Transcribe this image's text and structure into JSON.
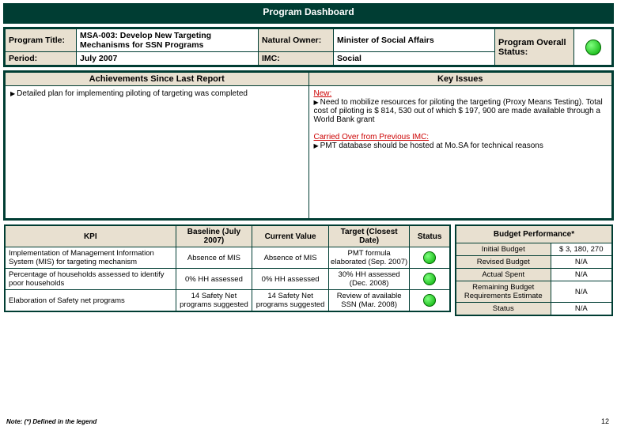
{
  "title": "Program Dashboard",
  "header": {
    "program_title_lbl": "Program Title:",
    "program_title_val": "MSA-003: Develop New Targeting Mechanisms for SSN Programs",
    "natural_owner_lbl": "Natural Owner:",
    "natural_owner_val": "Minister of Social Affairs",
    "period_lbl": "Period:",
    "period_val": "July 2007",
    "imc_lbl": "IMC:",
    "imc_val": "Social",
    "status_lbl": "Program Overall Status:"
  },
  "sections": {
    "achievements_hdr": "Achievements Since Last Report",
    "key_issues_hdr": "Key Issues",
    "achievement_1": "Detailed plan for implementing piloting of targeting was completed",
    "issues_new_lbl": "New:",
    "issues_new_1": "Need to mobilize resources for piloting the targeting (Proxy Means Testing). Total cost of piloting is $ 814, 530 out of which $ 197, 900 are made available through a World Bank grant",
    "issues_carried_lbl": "Carried Over from Previous IMC:",
    "issues_carried_1": "PMT database should be hosted at Mo.SA for technical reasons"
  },
  "kpi": {
    "hdr_kpi": "KPI",
    "hdr_baseline": "Baseline (July 2007)",
    "hdr_current": "Current Value",
    "hdr_target": "Target (Closest Date)",
    "hdr_status": "Status",
    "rows": [
      {
        "name": "Implementation of Management Information System (MIS) for  targeting mechanism",
        "baseline": "Absence of MIS",
        "current": "Absence of MIS",
        "target": "PMT formula elaborated (Sep. 2007)"
      },
      {
        "name": "Percentage of households assessed to identify poor households",
        "baseline": "0% HH assessed",
        "current": "0% HH assessed",
        "target": "30% HH assessed (Dec. 2008)"
      },
      {
        "name": "Elaboration of Safety net programs",
        "baseline": "14 Safety Net programs suggested",
        "current": "14 Safety Net programs suggested",
        "target": "Review of available SSN (Mar. 2008)"
      }
    ]
  },
  "budget": {
    "hdr": "Budget Performance*",
    "rows": [
      {
        "lbl": "Initial Budget",
        "val": "$ 3, 180, 270"
      },
      {
        "lbl": "Revised Budget",
        "val": "N/A"
      },
      {
        "lbl": "Actual Spent",
        "val": "N/A"
      },
      {
        "lbl": "Remaining Budget Requirements Estimate",
        "val": "N/A"
      },
      {
        "lbl": "Status",
        "val": "N/A"
      }
    ]
  },
  "note": "Note: (*) Defined in the legend",
  "page": "12"
}
